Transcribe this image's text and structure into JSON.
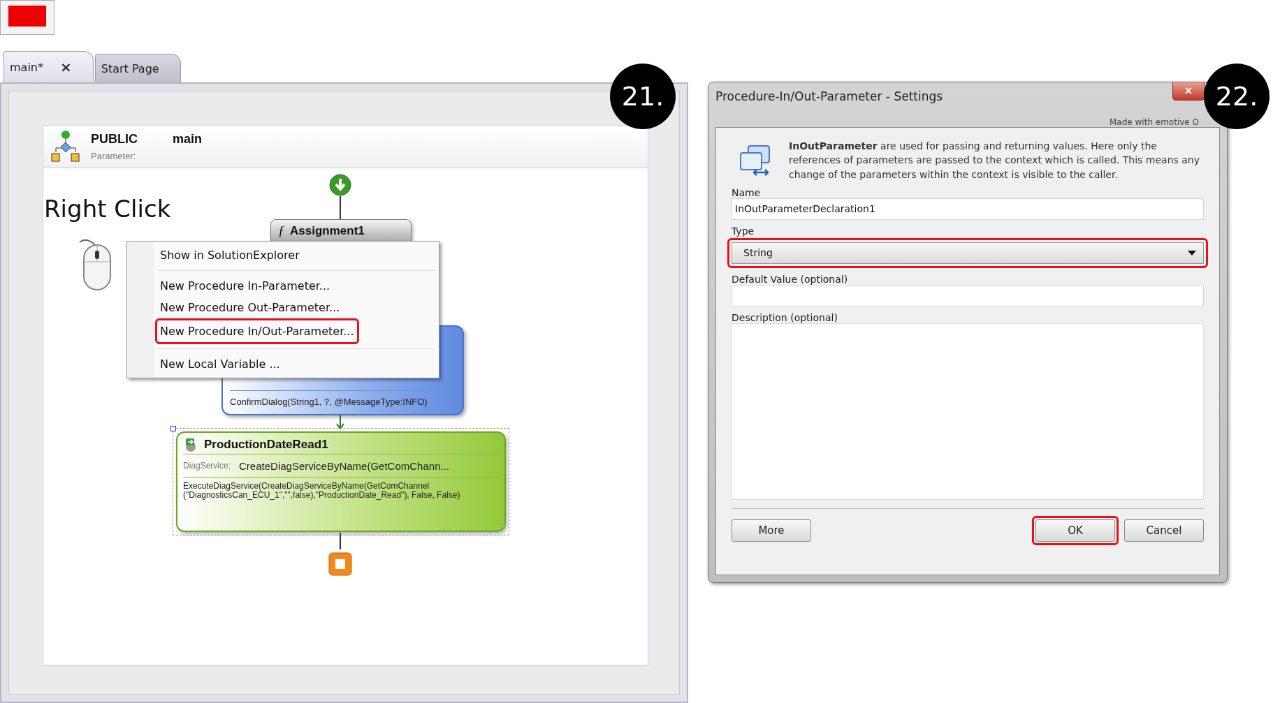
{
  "tabs": [
    {
      "label": "main*",
      "selected": true,
      "close": "×"
    },
    {
      "label": "Start Page",
      "selected": false
    }
  ],
  "steps": [
    "21.",
    "22."
  ],
  "procedure": {
    "visibility": "PUBLIC",
    "name": "main",
    "parameter_label": "Parameter:"
  },
  "hint": "Right Click",
  "nodes": [
    {
      "kind": "assignment",
      "icon": "ƒ",
      "title": "Assignment1"
    },
    {
      "kind": "dialog",
      "expression": "ConfirmDialog(String1, ?, @MessageType:INFO)"
    },
    {
      "kind": "diag",
      "title": "ProductionDateRead1",
      "field_label": "DiagService:",
      "field_value": "CreateDiagServiceByName(GetComChann...",
      "expression": "ExecuteDiagService(CreateDiagServiceByName(GetComChannel (\"DiagnosticsCan_ECU_1\",\"\",false),\"ProductionDate_Read\"), False, False)",
      "selected": true
    }
  ],
  "context_menu": [
    [
      {
        "label": "Show in SolutionExplorer",
        "highlighted": false
      }
    ],
    [
      {
        "label": "New Procedure In-Parameter...",
        "highlighted": false
      },
      {
        "label": "New Procedure Out-Parameter...",
        "highlighted": false
      },
      {
        "label": "New Procedure In/Out-Parameter...",
        "highlighted": true
      }
    ],
    [
      {
        "label": "New Local Variable ...",
        "highlighted": false
      }
    ]
  ],
  "dialog": {
    "title": "Procedure-In/Out-Parameter - Settings",
    "close": "×",
    "credit": "Made with emotive O",
    "info": "**InOutParameter** are used for passing and returning values. Here only the references of parameters are passed to the context which is called. This means any change of the parameters within the context is visible to the caller.",
    "fields": [
      {
        "kind": "text",
        "label": "Name",
        "value": "InOutParameterDeclaration1",
        "highlighted": false
      },
      {
        "kind": "select",
        "label": "Type",
        "value": "String",
        "highlighted": true
      },
      {
        "kind": "text",
        "label": "Default Value (optional)",
        "highlighted": false
      },
      {
        "kind": "textarea",
        "label": "Description (optional)",
        "highlighted": false
      }
    ],
    "buttons": [
      {
        "label": "More",
        "highlighted": false
      },
      {
        "label": "OK",
        "highlighted": true
      },
      {
        "label": "Cancel",
        "highlighted": false
      }
    ]
  }
}
